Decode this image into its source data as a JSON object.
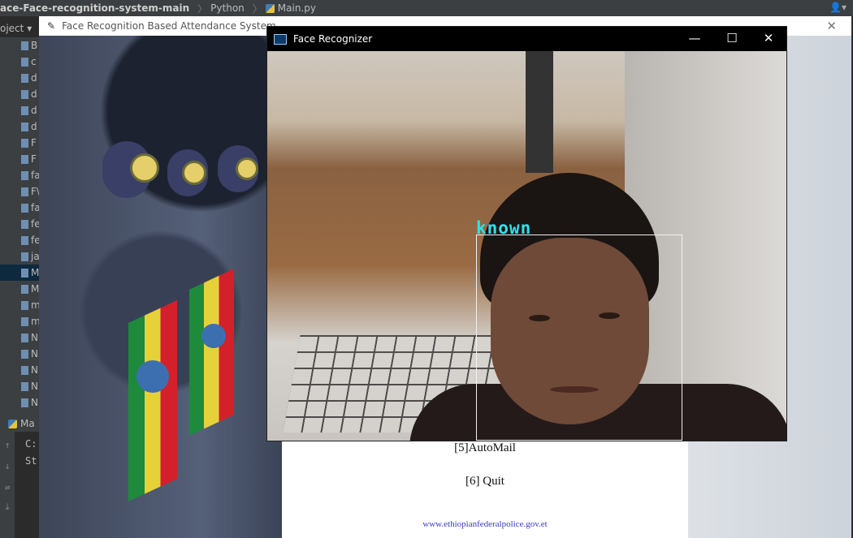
{
  "ide": {
    "project_name": "ace-Face-recognition-system-main",
    "crumb_python": "Python",
    "crumb_file": "Main.py",
    "project_label": "oject",
    "tree_items": [
      "B",
      "c",
      "d",
      "d",
      "d",
      "d",
      "F",
      "F",
      "fa",
      "F\\",
      "fa",
      "fe",
      "fe",
      "ja",
      "M",
      "M",
      "m",
      "m",
      "N",
      "N",
      "N",
      "N",
      "N"
    ],
    "selected_index": 14,
    "run_tab_label": "Ma",
    "run_lines": [
      "C:",
      "St"
    ]
  },
  "attendance_window": {
    "title": "Face Recognition Based Attendance System",
    "automail_label": "[5]AutoMail",
    "quit_label": "[6] Quit",
    "website": "www.ethiopianfederalpolice.gov.et"
  },
  "face_window": {
    "title": "Face Recognizer",
    "detected_label": "known",
    "box_color": "#f0f0f0",
    "label_color": "#2fe2ee"
  }
}
